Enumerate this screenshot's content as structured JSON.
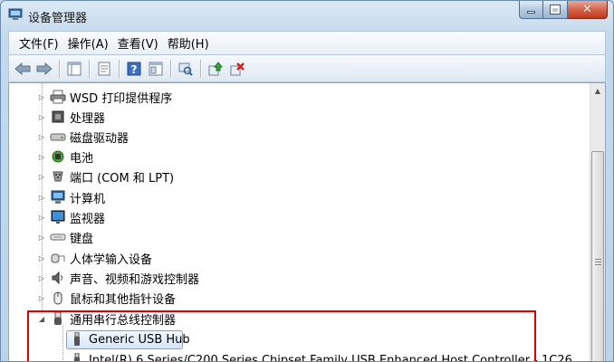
{
  "window": {
    "title": "设备管理器",
    "title_icon": "device-manager-icon"
  },
  "menu": [
    {
      "label": "文件(F)"
    },
    {
      "label": "操作(A)"
    },
    {
      "label": "查看(V)"
    },
    {
      "label": "帮助(H)"
    }
  ],
  "toolbar": [
    {
      "name": "back-arrow-icon"
    },
    {
      "name": "forward-arrow-icon"
    },
    {
      "name": "show-hide-console-tree-icon"
    },
    {
      "name": "properties-icon"
    },
    {
      "name": "help-icon"
    },
    {
      "name": "view-icon"
    },
    {
      "name": "scan-hardware-icon"
    },
    {
      "name": "update-driver-icon"
    },
    {
      "name": "uninstall-icon"
    }
  ],
  "tree": [
    {
      "label": "WSD 打印提供程序",
      "icon": "printer-icon",
      "expanded": false
    },
    {
      "label": "处理器",
      "icon": "processor-icon",
      "expanded": false
    },
    {
      "label": "磁盘驱动器",
      "icon": "disk-drive-icon",
      "expanded": false
    },
    {
      "label": "电池",
      "icon": "battery-icon",
      "expanded": false
    },
    {
      "label": "端口 (COM 和 LPT)",
      "icon": "port-icon",
      "expanded": false
    },
    {
      "label": "计算机",
      "icon": "computer-icon",
      "expanded": false
    },
    {
      "label": "监视器",
      "icon": "monitor-icon",
      "expanded": false
    },
    {
      "label": "键盘",
      "icon": "keyboard-icon",
      "expanded": false
    },
    {
      "label": "人体学输入设备",
      "icon": "hid-icon",
      "expanded": false
    },
    {
      "label": "声音、视频和游戏控制器",
      "icon": "sound-icon",
      "expanded": false
    },
    {
      "label": "鼠标和其他指针设备",
      "icon": "mouse-icon",
      "expanded": false
    },
    {
      "label": "通用串行总线控制器",
      "icon": "usb-icon",
      "expanded": true
    }
  ],
  "usb_children": [
    {
      "label": "Generic USB Hub",
      "selected": true
    },
    {
      "label": "Intel(R) 6 Series/C200 Series Chipset Family USB Enhanced Host Controller - 1C26",
      "selected": false
    }
  ],
  "colors": {
    "highlight_border": "#e00000",
    "selection": "#d5e6fb"
  }
}
